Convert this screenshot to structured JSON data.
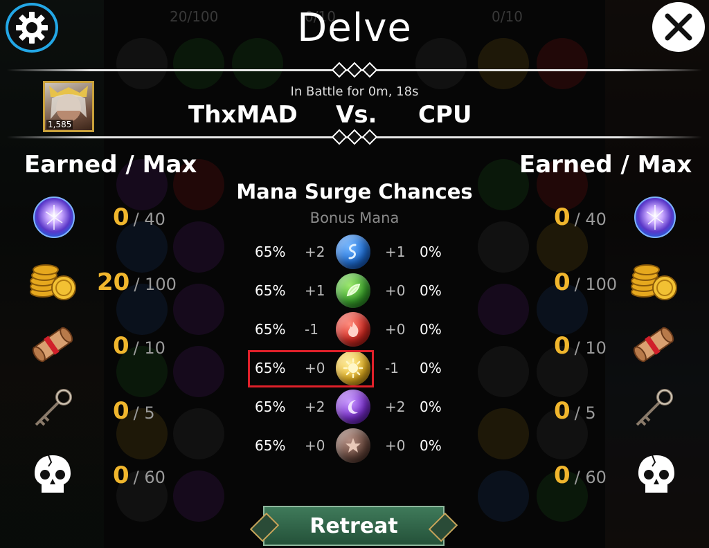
{
  "header": {
    "title": "Delve",
    "battle_time": "In Battle for 0m, 18s",
    "player_name": "ThxMAD",
    "vs_label": "Vs.",
    "opponent_name": "CPU",
    "player_rating": "1,585",
    "background_hud": [
      "20/100",
      "0/10",
      "0/10"
    ]
  },
  "left_panel": {
    "heading": "Earned / Max",
    "rows": [
      {
        "icon": "mana-orb-icon",
        "earned": "0",
        "max": "/ 40"
      },
      {
        "icon": "gold-coins-icon",
        "earned": "20",
        "max": "/ 100"
      },
      {
        "icon": "scroll-icon",
        "earned": "0",
        "max": "/ 10"
      },
      {
        "icon": "key-icon",
        "earned": "0",
        "max": "/ 5"
      },
      {
        "icon": "skull-icon",
        "earned": "0",
        "max": "/ 60"
      }
    ]
  },
  "right_panel": {
    "heading": "Earned / Max",
    "rows": [
      {
        "icon": "mana-orb-icon",
        "earned": "0",
        "max": "/ 40"
      },
      {
        "icon": "gold-coins-icon",
        "earned": "0",
        "max": "/ 100"
      },
      {
        "icon": "scroll-icon",
        "earned": "0",
        "max": "/ 10"
      },
      {
        "icon": "key-icon",
        "earned": "0",
        "max": "/ 5"
      },
      {
        "icon": "skull-icon",
        "earned": "0",
        "max": "/ 60"
      }
    ]
  },
  "mana_surge": {
    "title": "Mana Surge Chances",
    "subtitle": "Bonus Mana",
    "highlighted_row": 3,
    "rows": [
      {
        "color": "blue",
        "hex": "#1f6fd6",
        "left_pct": "65%",
        "left_bonus": "+2",
        "right_bonus": "+1",
        "right_pct": "0%"
      },
      {
        "color": "green",
        "hex": "#3aa52c",
        "left_pct": "65%",
        "left_bonus": "+1",
        "right_bonus": "+0",
        "right_pct": "0%"
      },
      {
        "color": "red",
        "hex": "#d42a22",
        "left_pct": "65%",
        "left_bonus": "-1",
        "right_bonus": "+0",
        "right_pct": "0%"
      },
      {
        "color": "yellow",
        "hex": "#e8b320",
        "left_pct": "65%",
        "left_bonus": "+0",
        "right_bonus": "-1",
        "right_pct": "0%"
      },
      {
        "color": "purple",
        "hex": "#7b2fd0",
        "left_pct": "65%",
        "left_bonus": "+2",
        "right_bonus": "+2",
        "right_pct": "0%"
      },
      {
        "color": "brown",
        "hex": "#6b4a3f",
        "left_pct": "65%",
        "left_bonus": "+0",
        "right_bonus": "+0",
        "right_pct": "0%"
      }
    ]
  },
  "footer": {
    "retreat_label": "Retreat"
  },
  "colors": {
    "accent_gold": "#f0b62d",
    "gear_ring": "#23a7e6",
    "highlight": "#e0202a",
    "retreat_green": "#2f6a4a"
  }
}
